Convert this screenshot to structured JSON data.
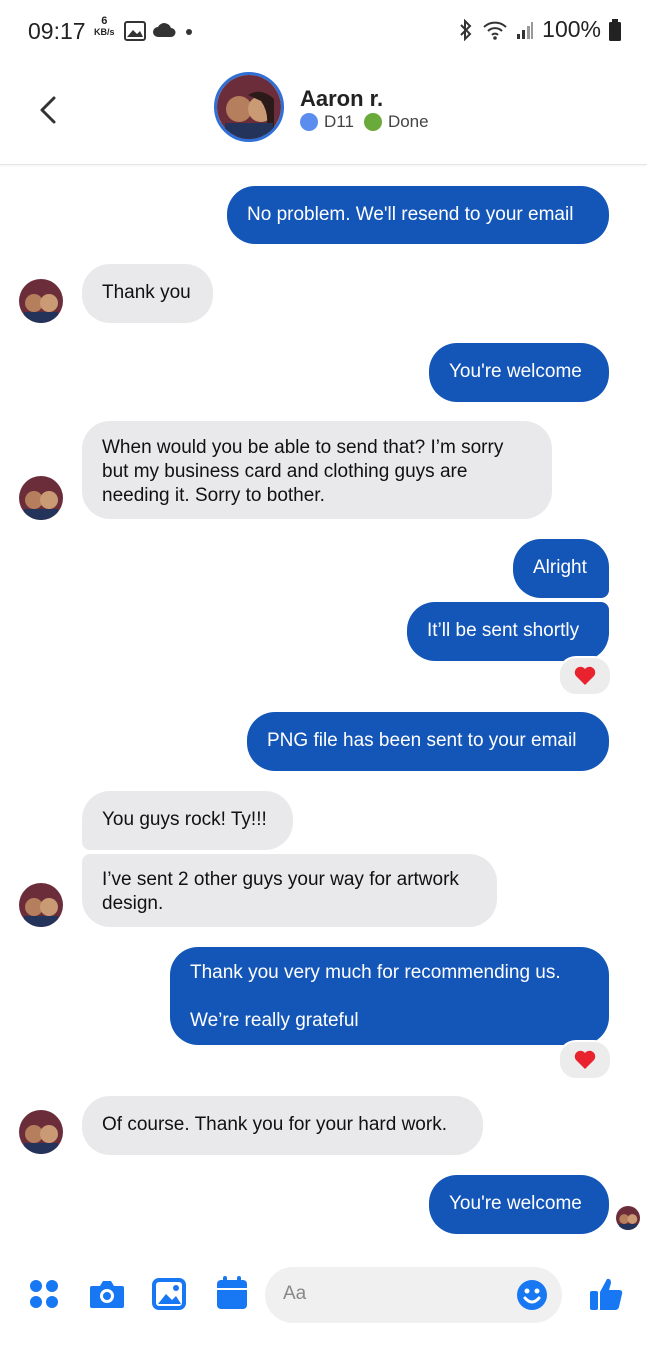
{
  "status_bar": {
    "time": "09:17",
    "speed_value": "6",
    "speed_unit": "KB/s",
    "battery": "100%"
  },
  "header": {
    "contact_name": "Aaron r.",
    "tag1_label": "D11",
    "tag1_color": "#5b8def",
    "tag2_label": "Done",
    "tag2_color": "#6aaa3a"
  },
  "messages": [
    {
      "side": "out",
      "text": "No problem. We'll resend to your email"
    },
    {
      "side": "in",
      "text": "Thank you"
    },
    {
      "side": "out",
      "text": "You're welcome"
    },
    {
      "side": "in",
      "text": "When would you be able to send that? I’m sorry\nbut my business card and clothing guys are\nneeding it.  Sorry to bother."
    },
    {
      "side": "out",
      "text": "Alright"
    },
    {
      "side": "out",
      "text": "It’ll be sent shortly",
      "reaction": "heart"
    },
    {
      "side": "out",
      "text": "PNG file has been sent to your email"
    },
    {
      "side": "in",
      "text": "You guys rock! Ty!!!"
    },
    {
      "side": "in",
      "text": "I’ve sent 2 other guys your way for artwork\ndesign."
    },
    {
      "side": "out",
      "text": "Thank you very much for recommending us.\n\nWe’re really grateful",
      "reaction": "heart"
    },
    {
      "side": "in",
      "text": "Of course. Thank you for your hard work."
    },
    {
      "side": "out",
      "text": "You're welcome"
    }
  ],
  "composer": {
    "placeholder": "Aa",
    "icons": [
      "apps-icon",
      "camera-icon",
      "gallery-icon",
      "calendar-icon",
      "emoji-icon",
      "thumbs-up-icon"
    ]
  },
  "colors": {
    "outgoing_bubble": "#1456b8",
    "incoming_bubble": "#e9e9eb",
    "accent": "#1877f2"
  }
}
